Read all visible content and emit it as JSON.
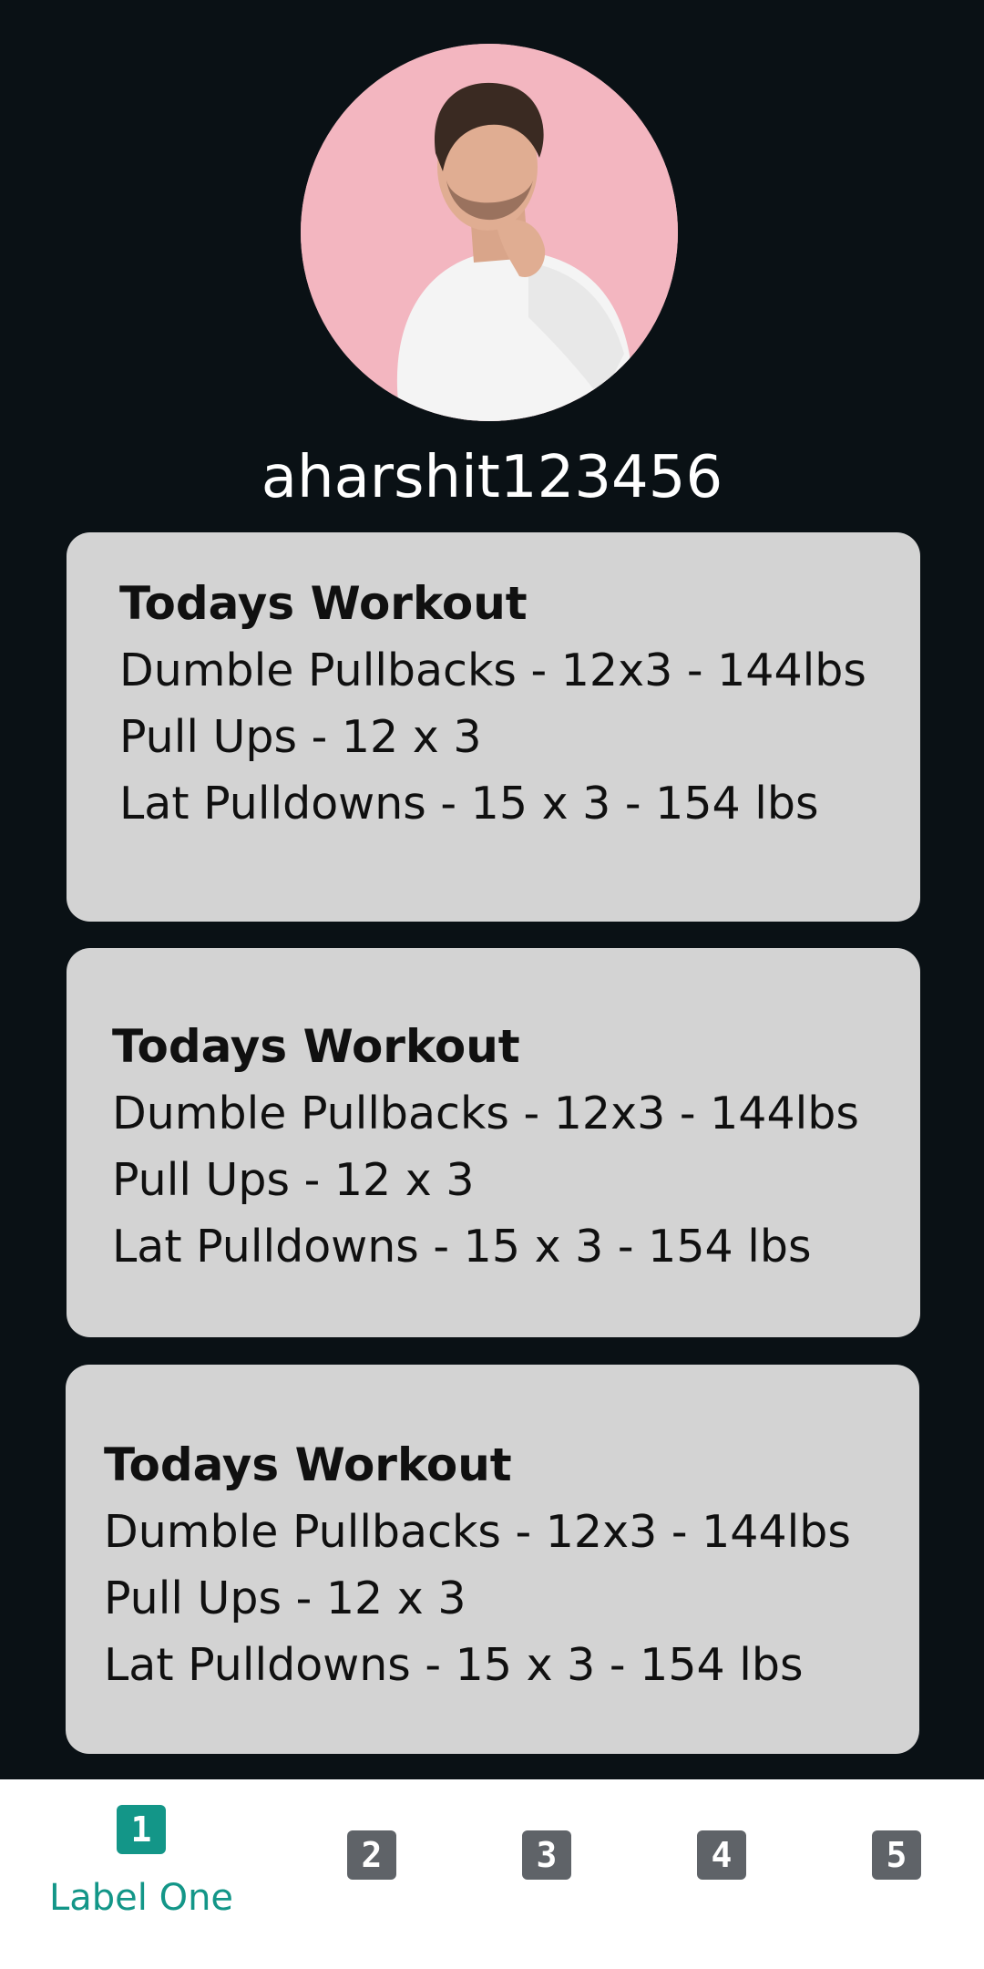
{
  "profile": {
    "username": "aharshit123456"
  },
  "cards": [
    {
      "title": "Todays Workout",
      "lines": [
        "Dumble Pullbacks - 12x3 - 144lbs",
        "Pull Ups - 12 x 3",
        "Lat Pulldowns - 15 x 3 - 154 lbs"
      ]
    },
    {
      "title": "Todays Workout",
      "lines": [
        "Dumble Pullbacks - 12x3 - 144lbs",
        "Pull Ups - 12 x 3",
        "Lat Pulldowns - 15 x 3 - 154 lbs"
      ]
    },
    {
      "title": "Todays Workout",
      "lines": [
        "Dumble Pullbacks - 12x3 - 144lbs",
        "Pull Ups - 12 x 3",
        "Lat Pulldowns - 15 x 3 - 154 lbs"
      ]
    }
  ],
  "bottom_nav": {
    "items": [
      {
        "icon": "1",
        "label": "Label One",
        "selected": true
      },
      {
        "icon": "2"
      },
      {
        "icon": "3"
      },
      {
        "icon": "4"
      },
      {
        "icon": "5"
      }
    ],
    "active_color": "#139688",
    "inactive_color": "#5f6368"
  },
  "colors": {
    "background": "#0a1115",
    "card": "#d3d3d3"
  }
}
